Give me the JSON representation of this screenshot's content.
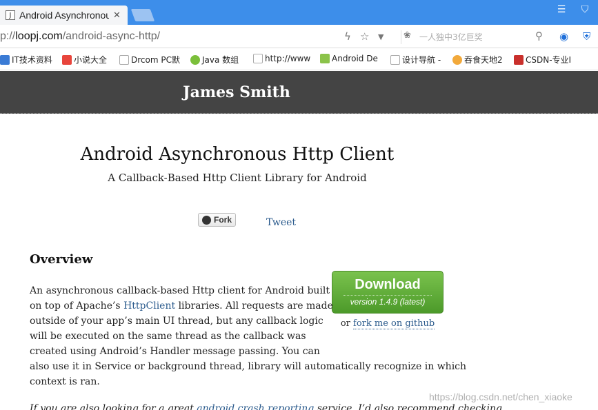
{
  "browser": {
    "tab_title": "Android Asynchronous",
    "tab_favicon": "J",
    "url_prefix": "p://",
    "url_host": "loopj.com",
    "url_path": "/android-async-http/",
    "search_placeholder": "一人独中3亿巨奖"
  },
  "bookmarks": [
    {
      "label": "IT技术资料",
      "color": "#3a7bd5"
    },
    {
      "label": "小说大全",
      "color": "#e8453c"
    },
    {
      "label": "Drcom PC默",
      "color": "#cccccc"
    },
    {
      "label": "Java 数组",
      "color": "#7bbf3a"
    },
    {
      "label": "http://www",
      "color": "#cccccc"
    },
    {
      "label": "Android De",
      "color": "#8bc34a"
    },
    {
      "label": "设计导航 -",
      "color": "#cccccc"
    },
    {
      "label": "吞食天地2",
      "color": "#f2a93b"
    },
    {
      "label": "CSDN-专业I",
      "color": "#c9302c"
    }
  ],
  "site": {
    "name": "James Smith",
    "title": "Android Asynchronous Http Client",
    "subtitle": "A Callback-Based Http Client Library for Android",
    "fork_label": "Fork",
    "tweet_label": "Tweet",
    "overview_heading": "Overview",
    "download_label": "Download",
    "download_version": "version 1.4.9 (latest)",
    "fork_prefix": "or ",
    "fork_link": "fork me on github",
    "para_lines": [
      "An asynchronous callback-based Http client for Android built",
      "libraries. All requests are made",
      "outside of your app’s main UI thread, but any callback logic",
      "will be executed on the same thread as the callback was",
      "created using Android’s Handler message passing. You can",
      "also use it in Service or background thread, library will automatically recognize in which",
      "context is ran."
    ],
    "para_line2_prefix": "on top of Apache’s ",
    "httpclient_link": "HttpClient",
    "para2_prefix": "If you are also looking for a great ",
    "para2_link": "android crash reporting",
    "para2_suffix": " service, I’d also recommend checking"
  },
  "watermark": "https://blog.csdn.net/chen_xiaoke"
}
